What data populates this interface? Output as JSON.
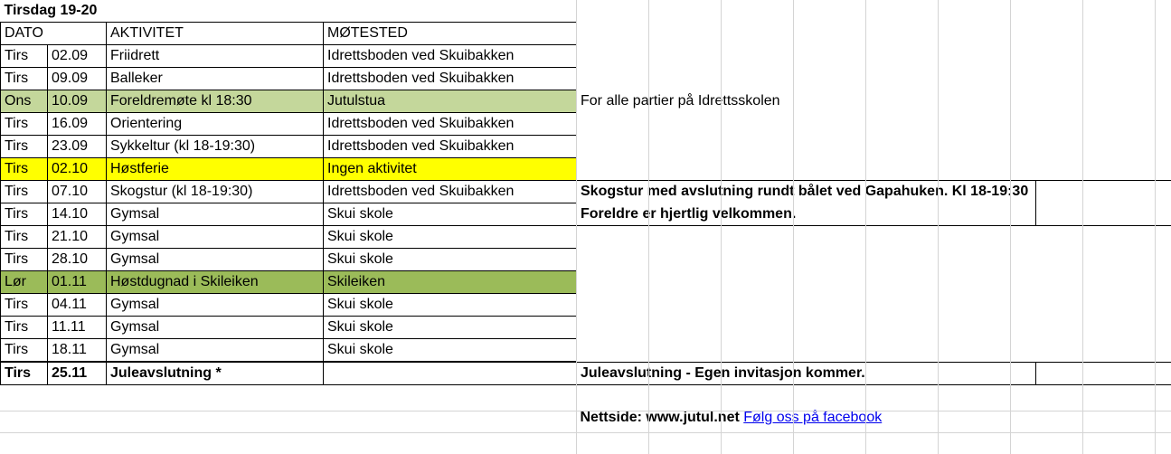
{
  "title": "Tirsdag 19-20",
  "headers": {
    "a": "DATO",
    "b": "AKTIVITET",
    "c": "MØTESTED"
  },
  "rows": [
    {
      "day": "Tirs",
      "date": "02.09",
      "activity": "Friidrett",
      "place": "Idrettsboden ved Skuibakken",
      "note": "",
      "hl": ""
    },
    {
      "day": "Tirs",
      "date": "09.09",
      "activity": "Balleker",
      "place": "Idrettsboden ved Skuibakken",
      "note": "",
      "hl": ""
    },
    {
      "day": "Ons",
      "date": "10.09",
      "activity": "Foreldremøte kl 18:30",
      "place": "Jutulstua",
      "note": "For alle partier på Idrettsskolen",
      "hl": "lightgreen"
    },
    {
      "day": "Tirs",
      "date": "16.09",
      "activity": "Orientering",
      "place": "Idrettsboden ved Skuibakken",
      "note": "",
      "hl": ""
    },
    {
      "day": "Tirs",
      "date": "23.09",
      "activity": "Sykkeltur (kl 18-19:30)",
      "place": "Idrettsboden ved Skuibakken",
      "note": "",
      "hl": ""
    },
    {
      "day": "Tirs",
      "date": "02.10",
      "activity": "Høstferie",
      "place": "Ingen aktivitet",
      "note": "",
      "hl": "yellow"
    },
    {
      "day": "Tirs",
      "date": "07.10",
      "activity": "Skogstur (kl 18-19:30)",
      "place": "Idrettsboden ved Skuibakken",
      "note": "Skogstur med avslutning rundt bålet ved Gapahuken. Kl 18-19:30",
      "hl": ""
    },
    {
      "day": "Tirs",
      "date": "14.10",
      "activity": "Gymsal",
      "place": "Skui skole",
      "note": "Foreldre er hjertlig velkommen.",
      "hl": ""
    },
    {
      "day": "Tirs",
      "date": "21.10",
      "activity": "Gymsal",
      "place": "Skui skole",
      "note": "",
      "hl": ""
    },
    {
      "day": "Tirs",
      "date": "28.10",
      "activity": "Gymsal",
      "place": "Skui skole",
      "note": "",
      "hl": ""
    },
    {
      "day": "Lør",
      "date": "01.11",
      "activity": "Høstdugnad i Skileiken",
      "place": "Skileiken",
      "note": "",
      "hl": "green"
    },
    {
      "day": "Tirs",
      "date": "04.11",
      "activity": "Gymsal",
      "place": "Skui skole",
      "note": "",
      "hl": ""
    },
    {
      "day": "Tirs",
      "date": "11.11",
      "activity": "Gymsal",
      "place": "Skui skole",
      "note": "",
      "hl": ""
    },
    {
      "day": "Tirs",
      "date": "18.11",
      "activity": "Gymsal",
      "place": "Skui skole",
      "note": "",
      "hl": ""
    },
    {
      "day": "Tirs",
      "date": "25.11",
      "activity": "Juleavslutning *",
      "place": "",
      "note": "Juleavslutning - Egen invitasjon kommer.",
      "hl": "bold"
    }
  ],
  "footer": {
    "nettside_label": "Nettside: www.jutul.net",
    "facebook_label": "Følg oss på facebook"
  }
}
